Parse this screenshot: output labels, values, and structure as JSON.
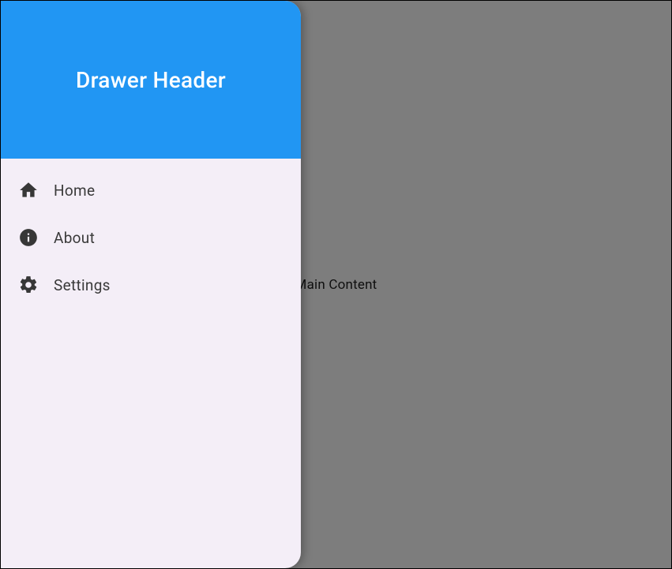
{
  "drawer": {
    "header_title": "Drawer Header",
    "items": [
      {
        "icon": "home-icon",
        "label": "Home"
      },
      {
        "icon": "info-icon",
        "label": "About"
      },
      {
        "icon": "settings-icon",
        "label": "Settings"
      }
    ]
  },
  "main": {
    "content_text": "Main Content"
  },
  "colors": {
    "header_bg": "#2196F3",
    "drawer_bg": "#f4eef7",
    "icon": "#373737",
    "scrim": "rgba(0,0,0,0.50)"
  }
}
